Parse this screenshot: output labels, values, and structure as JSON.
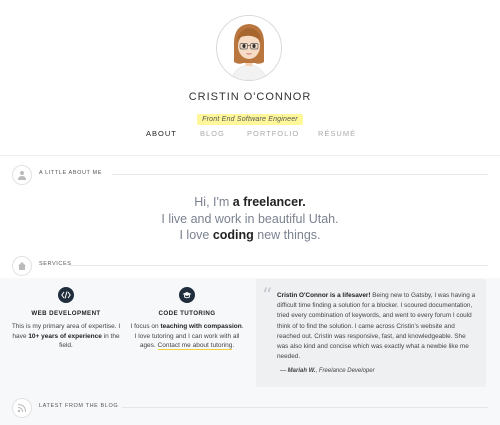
{
  "profile": {
    "name": "CRISTIN O'CONNOR",
    "role": "Front End Software Engineer",
    "avatar_icon": "avatar-illustration"
  },
  "nav": {
    "items": [
      {
        "label": "ABOUT",
        "active": true
      },
      {
        "label": "BLOG",
        "active": false
      },
      {
        "label": "PORTFOLIO",
        "active": false
      },
      {
        "label": "RÉSUMÉ",
        "active": false
      }
    ]
  },
  "about": {
    "section_title": "A LITTLE ABOUT ME",
    "icon": "person-icon",
    "line1_pre": "Hi, I'm ",
    "line1_bold": "a freelancer.",
    "line2": "I live and work in beautiful Utah.",
    "line3_pre": "I love ",
    "line3_bold": "coding",
    "line3_post": " new things."
  },
  "services": {
    "section_title": "SERVICES",
    "icon": "home-icon",
    "items": [
      {
        "icon": "code-icon",
        "title": "WEB DEVELOPMENT",
        "desc_1": "This is my primary area of expertise. I have ",
        "desc_bold": "10+ years of experience",
        "desc_2": " in the field."
      },
      {
        "icon": "graduation-cap-icon",
        "title": "CODE TUTORING",
        "desc_1": "I focus on ",
        "desc_bold1": "teaching with compassion",
        "desc_2": ". I love tutoring and I can work with all ages. ",
        "desc_link": "Contact me about tutoring",
        "desc_3": "."
      }
    ]
  },
  "testimonial": {
    "bold": "Cristin O'Connor is a lifesaver!",
    "text": " Being new to Gatsby, I was having a difficult time finding a solution for a blocker. I scoured documentation, tried every combination of keywords, and went to every forum I could think of to find the solution. I came across Cristin's website and reached out. Cristin was responsive, fast, and knowledgeable. She was also kind and concise which was exactly what a newbie like me needed.",
    "author_prefix": "— ",
    "author_name": "Mariah W.",
    "author_title": ", Freelance Developer"
  },
  "blog": {
    "section_title": "LATEST FROM THE BLOG",
    "icon": "rss-icon"
  },
  "colors": {
    "highlight": "#fff799",
    "dark_icon_bg": "#1f2d3d",
    "link_underline": "#f0d23c"
  }
}
